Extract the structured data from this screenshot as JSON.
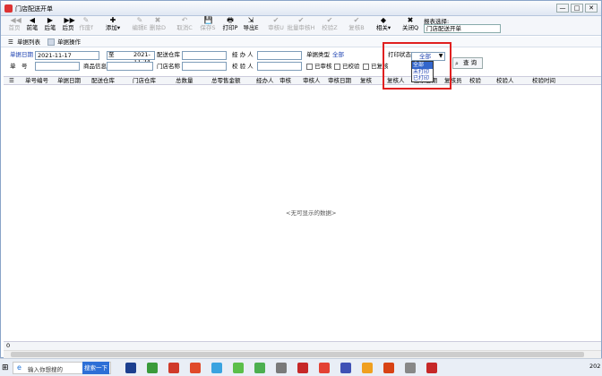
{
  "window": {
    "title": "门店配送开单",
    "min": "—",
    "max": "□",
    "close": "✕"
  },
  "toolbar": {
    "items": [
      {
        "icon": "◀◀",
        "label": "首页",
        "enabled": false
      },
      {
        "icon": "◀",
        "label": "前笔",
        "enabled": true
      },
      {
        "icon": "▶",
        "label": "后笔",
        "enabled": true
      },
      {
        "icon": "▶▶",
        "label": "后页",
        "enabled": true
      },
      {
        "icon": "✎",
        "label": "作废f",
        "enabled": false
      },
      {
        "icon": "✚",
        "label": "添加▾",
        "enabled": true
      },
      {
        "icon": "✎",
        "label": "编辑E",
        "enabled": false
      },
      {
        "icon": "✖",
        "label": "删除D",
        "enabled": false
      },
      {
        "icon": "↶",
        "label": "取消C",
        "enabled": false
      },
      {
        "icon": "💾",
        "label": "保存S",
        "enabled": false
      },
      {
        "icon": "🖶",
        "label": "打印P",
        "enabled": true
      },
      {
        "icon": "⇲",
        "label": "导出E",
        "enabled": true
      },
      {
        "icon": "✔",
        "label": "审核U",
        "enabled": false
      },
      {
        "icon": "✔",
        "label": "批量审核H",
        "enabled": false
      },
      {
        "icon": "✔",
        "label": "校验Z",
        "enabled": false
      },
      {
        "icon": "✔",
        "label": "复核B",
        "enabled": false
      },
      {
        "icon": "◆",
        "label": "相关▾",
        "enabled": true
      },
      {
        "icon": "✖",
        "label": "关闭Q",
        "enabled": true
      }
    ]
  },
  "report": {
    "label": "报表选择:",
    "value": "门店配送开单"
  },
  "tabs": [
    {
      "label": "单据列表"
    },
    {
      "label": "单据操作"
    }
  ],
  "filters": {
    "doc_date_label": "单据日期",
    "date_from": "2021-11-17",
    "to_label": "至",
    "date_to": "2021-11-24",
    "warehouse_label": "配送仓库",
    "handler_label": "经 办 人",
    "doc_type_label": "单据类型",
    "doc_type_value": "全部",
    "docno_label": "单　号",
    "goods_label": "商品信息",
    "store_label": "门店名称",
    "checker_label": "校 验 人",
    "audited_label": "已审核",
    "checked_label": "已校验",
    "reviewed_label": "已复核",
    "print_status_label": "打印状态",
    "print_status_value": "全部",
    "print_status_options": [
      "全部",
      "未打印",
      "已打印"
    ],
    "query_button": "查 询"
  },
  "grid": {
    "columns": [
      "单号编号",
      "单据日期",
      "配送仓库",
      "门店仓库",
      "总数量",
      "总零售金额",
      "经办人",
      "审核",
      "审核人",
      "审核日期",
      "复核",
      "复核人",
      "复核日期",
      "复核员",
      "校验",
      "校验人",
      "校验时间"
    ],
    "empty_text": "<无可显示的数据>",
    "footer_count": "0"
  },
  "taskbar": {
    "search_placeholder": "输入你想搜的",
    "search_button": "搜索一下",
    "clock": "202"
  }
}
